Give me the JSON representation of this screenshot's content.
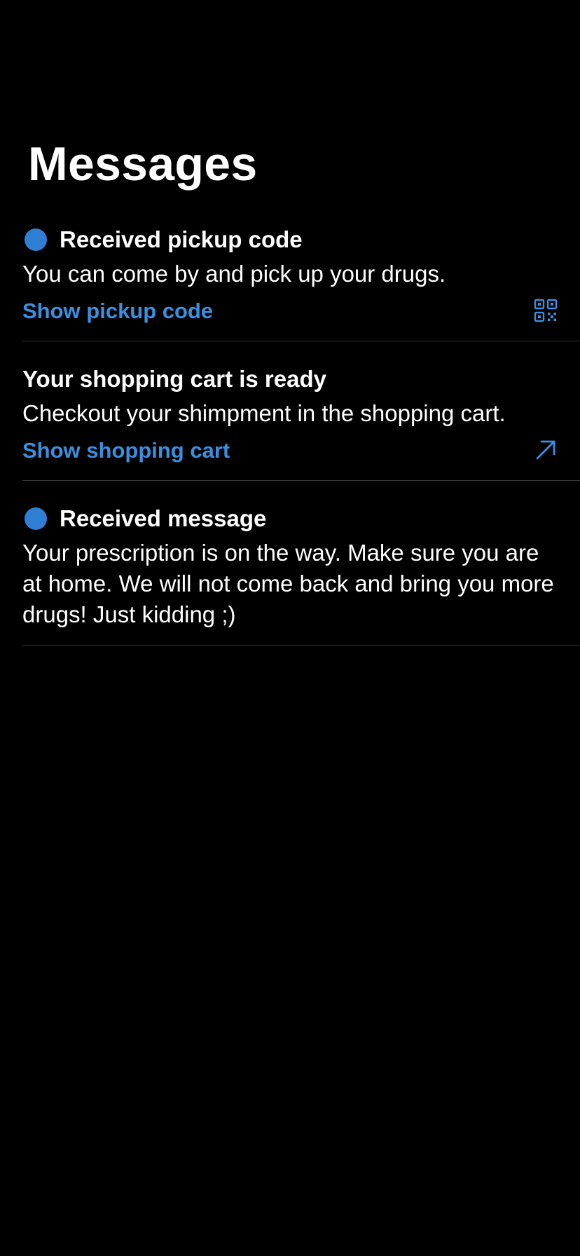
{
  "page": {
    "title": "Messages"
  },
  "messages": [
    {
      "unread": true,
      "title": "Received pickup code",
      "body": "You can come by and pick up your drugs.",
      "link_label": "Show pickup code",
      "icon": "qr-code-icon"
    },
    {
      "unread": false,
      "title": "Your shopping cart is ready",
      "body": "Checkout your shimpment in the shopping cart.",
      "link_label": "Show shopping cart",
      "icon": "arrow-up-right-icon"
    },
    {
      "unread": true,
      "title": "Received message",
      "body": "Your prescription is on the way. Make sure you are at home. We will not come back and bring you more drugs! Just kidding ;)"
    }
  ],
  "colors": {
    "background": "#000000",
    "accent": "#3b8fde",
    "unread_dot": "#2f80d4",
    "separator": "#38383a",
    "text": "#ffffff"
  }
}
